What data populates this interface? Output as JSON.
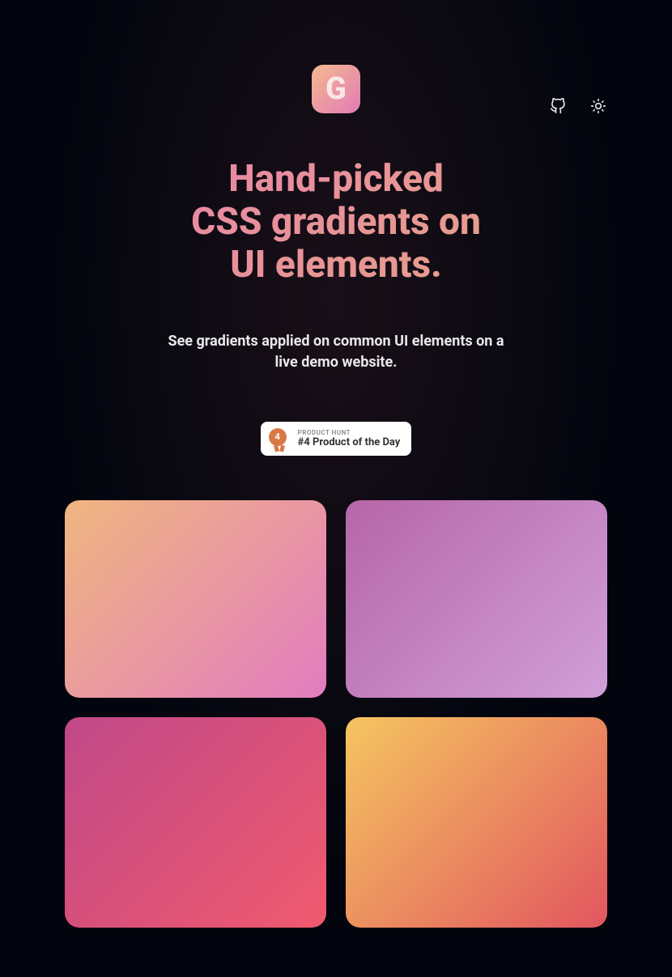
{
  "header": {
    "github_icon": "github-icon",
    "theme_icon": "sun-icon"
  },
  "logo": {
    "letter": "G"
  },
  "hero": {
    "title_line1": "Hand-picked",
    "title_line2": "CSS gradients on",
    "title_line3": "UI elements.",
    "subtitle": "See gradients applied on common UI elements on a live demo website."
  },
  "product_hunt": {
    "medal_number": "4",
    "label": "PRODUCT HUNT",
    "rank": "#4 Product of the Day"
  },
  "gradients": [
    {
      "name": "gradient-peach-pink",
      "colors": [
        "#f0b67f",
        "#e27cc0"
      ]
    },
    {
      "name": "gradient-purple-lavender",
      "colors": [
        "#b666a8",
        "#d19fd8"
      ]
    },
    {
      "name": "gradient-magenta-red",
      "colors": [
        "#c04888",
        "#f05a6e"
      ]
    },
    {
      "name": "gradient-yellow-red",
      "colors": [
        "#f5c560",
        "#e2565f"
      ]
    }
  ]
}
